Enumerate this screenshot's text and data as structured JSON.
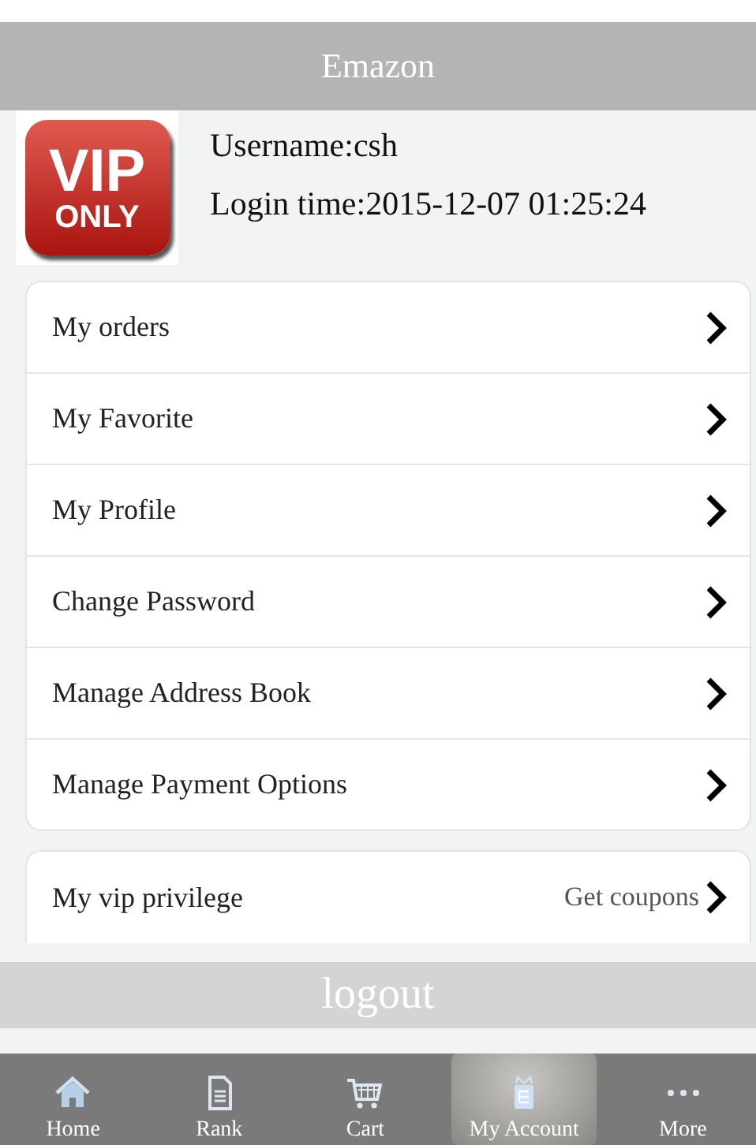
{
  "header": {
    "title": "Emazon"
  },
  "profile": {
    "badge": {
      "line1": "VIP",
      "line2": "ONLY"
    },
    "username": "Username:csh",
    "login_time": "Login time:2015-12-07 01:25:24"
  },
  "menu": [
    {
      "label": "My orders"
    },
    {
      "label": "My Favorite"
    },
    {
      "label": "My Profile"
    },
    {
      "label": "Change Password"
    },
    {
      "label": "Manage Address Book"
    },
    {
      "label": "Manage Payment Options"
    }
  ],
  "vip": {
    "label": "My vip privilege",
    "hint": "Get coupons"
  },
  "logout": "logout",
  "tabs": [
    {
      "kind": "home",
      "label": "Home",
      "selected": false
    },
    {
      "kind": "rank",
      "label": "Rank",
      "selected": false
    },
    {
      "kind": "cart",
      "label": "Cart",
      "selected": false
    },
    {
      "kind": "account",
      "label": "My Account",
      "selected": true
    },
    {
      "kind": "more",
      "label": "More",
      "selected": false
    }
  ]
}
